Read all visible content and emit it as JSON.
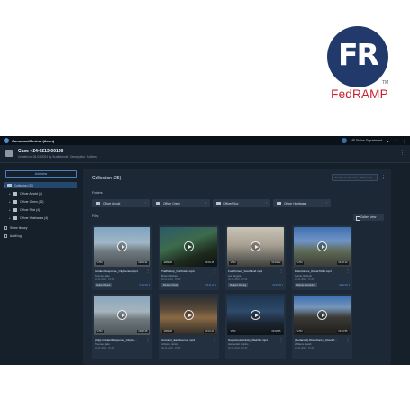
{
  "logo": {
    "letters": "FR",
    "tm": "TM",
    "word": "FedRAMP"
  },
  "topbar": {
    "app_title": "CommandCentral (Axon)",
    "department": "MS Police Department"
  },
  "case": {
    "title": "Case - 24-0213-00136",
    "subtitle": "Created on 06-03-2024 by Scott Arnold · Description: Robbery"
  },
  "sidebar": {
    "add_view": "Add view",
    "tree": [
      {
        "label": "Collection (25)",
        "selected": true
      },
      {
        "label": "Officer Arnold (4)"
      },
      {
        "label": "Officer Green (12)"
      },
      {
        "label": "Officer Ruiz (4)"
      },
      {
        "label": "Officer Hoshiwara (4)"
      }
    ],
    "links": [
      "Share history",
      "Audit log"
    ]
  },
  "main": {
    "title": "Collection (25)",
    "search_placeholder": "Find by media name, official, date...",
    "folders_label": "Folders",
    "files_label": "Files",
    "gallery_view": "Gallery view",
    "folders": [
      "Officer Arnold",
      "Officer Green",
      "Officer Ruiz",
      "Officer Hoshiwara"
    ]
  },
  "files": [
    {
      "name": "IncidentResponse_CityCenter.mp4",
      "owner": "Thomas, Jake",
      "date": "02-21-2023 · 15:30",
      "badge": "V700",
      "dur": "00:02:31",
      "tag": "Active Pursuit",
      "link": "00:02:00 ▾"
    },
    {
      "name": "TrafficStop_Northside.mp4",
      "owner": "Brown, Michael",
      "date": "02-21-2023 · 15:30",
      "badge": "ARMOR",
      "dur": "00:01:15",
      "tag": "Routine Check",
      "link": "00:01:00 ▾"
    },
    {
      "name": "FootPursuit_SouthEnd.mp4",
      "owner": "Lee, Angela",
      "date": "02-21-2023 · 15:30",
      "badge": "V700",
      "dur": "00:03:12",
      "tag": "Weapon Fleeing",
      "link": "00:03:00 ▾"
    },
    {
      "name": "Disturbance_Route70tall.mp4",
      "owner": "Garcia, Roberto",
      "date": "02-21-2023 · 15:30",
      "badge": "V700",
      "dur": "00:02:10",
      "tag": "Dispute Resolution",
      "link": "00:02:00 ▾"
    },
    {
      "name": "(Clip) IncidentResponse_CityCe...",
      "owner": "Thomas, Jake",
      "date": "02-21-2023 · 15:30",
      "badge": "V700",
      "dur": "00:00:45",
      "tag": "",
      "link": ""
    },
    {
      "name": "Accident_EastAvenue.mp4",
      "owner": "Johnson, Emily",
      "date": "02-21-2023 · 15:30",
      "badge": "ARMOR",
      "dur": "00:01:40",
      "tag": "",
      "link": ""
    },
    {
      "name": "SuspiciousActivity_MainStr.mp4",
      "owner": "Hernandez, Carlos",
      "date": "02-21-2023 · 15:30",
      "badge": "V700",
      "dur": "00:02:05",
      "tag": "",
      "link": ""
    },
    {
      "name": "(Redacted) Disturbance_Route7...",
      "owner": "Williams, Sarah",
      "date": "02-21-2023 · 15:30",
      "badge": "V700",
      "dur": "00:01:55",
      "tag": "",
      "link": ""
    }
  ],
  "colors": {
    "logo_blue": "#213a6b",
    "logo_red": "#c8202f",
    "app_bg": "#16202b",
    "panel_bg": "#1c2835",
    "accent_blue": "#4a8fd8"
  }
}
